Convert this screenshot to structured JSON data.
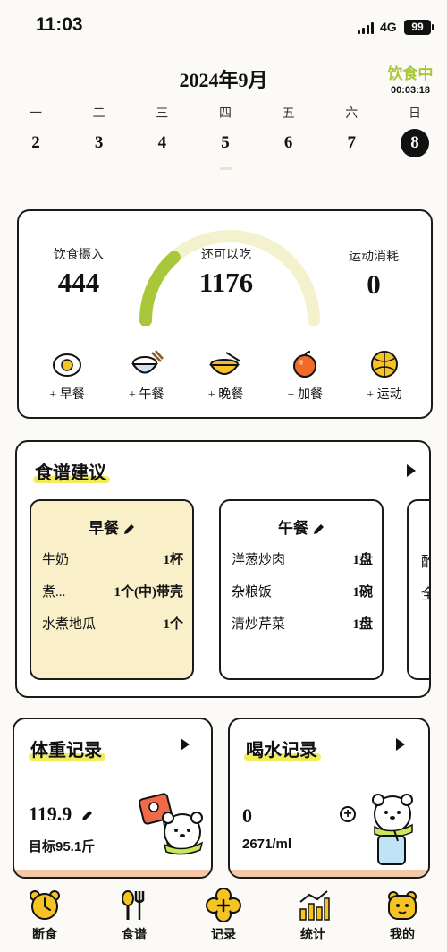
{
  "status_bar": {
    "time": "11:03",
    "network": "4G",
    "battery": "99"
  },
  "calendar": {
    "month": "2024年9月",
    "fasting_label": "饮食中",
    "fasting_timer": "00:03:18",
    "weekdays": [
      "一",
      "二",
      "三",
      "四",
      "五",
      "六",
      "日"
    ],
    "dates": [
      "2",
      "3",
      "4",
      "5",
      "6",
      "7",
      "8"
    ],
    "selected_date": "8"
  },
  "summary": {
    "intake_label": "饮食摄入",
    "intake_value": "444",
    "remaining_label": "还可以吃",
    "remaining_value": "1176",
    "exercise_label": "运动消耗",
    "exercise_value": "0",
    "gauge_progress": 0.27,
    "colors": {
      "gauge_fill": "#a9c73a",
      "gauge_track": "#f4f2cc"
    },
    "quick_actions": [
      {
        "label": "+ 早餐",
        "icon": "egg-icon"
      },
      {
        "label": "+ 午餐",
        "icon": "rice-bowl-icon"
      },
      {
        "label": "+ 晚餐",
        "icon": "noodle-bowl-icon"
      },
      {
        "label": "+ 加餐",
        "icon": "apple-icon"
      },
      {
        "label": "+ 运动",
        "icon": "ball-icon"
      }
    ]
  },
  "recipe": {
    "title": "食谱建议",
    "breakfast": {
      "title": "早餐",
      "items": [
        {
          "food": "牛奶",
          "qty": "1杯"
        },
        {
          "food": "煮...",
          "qty": "1个(中)带壳"
        },
        {
          "food": "水煮地瓜",
          "qty": "1个"
        }
      ]
    },
    "lunch": {
      "title": "午餐",
      "items": [
        {
          "food": "洋葱炒肉",
          "qty": "1盘"
        },
        {
          "food": "杂粮饭",
          "qty": "1碗"
        },
        {
          "food": "清炒芹菜",
          "qty": "1盘"
        }
      ]
    },
    "peek": {
      "line1": "酢",
      "line2": "全"
    }
  },
  "weight": {
    "title": "体重记录",
    "value": "119.9",
    "target": "目标95.1斤"
  },
  "water": {
    "title": "喝水记录",
    "value": "0",
    "total": "2671/ml"
  },
  "tabs": [
    {
      "label": "断食",
      "icon": "alarm-clock-icon"
    },
    {
      "label": "食谱",
      "icon": "fork-spoon-icon"
    },
    {
      "label": "记录",
      "icon": "flower-plus-icon"
    },
    {
      "label": "统计",
      "icon": "bar-chart-icon"
    },
    {
      "label": "我的",
      "icon": "bear-face-icon"
    }
  ]
}
